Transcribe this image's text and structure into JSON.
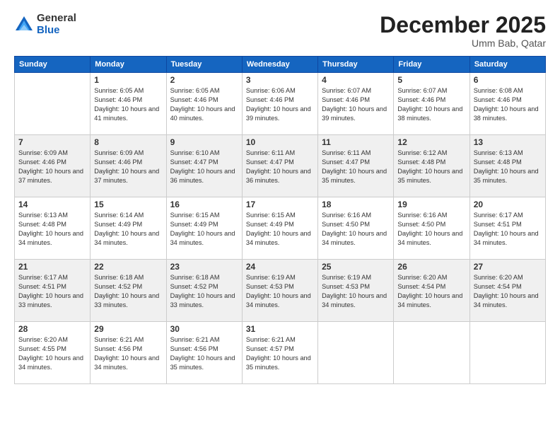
{
  "logo": {
    "general": "General",
    "blue": "Blue"
  },
  "title": "December 2025",
  "location": "Umm Bab, Qatar",
  "days_of_week": [
    "Sunday",
    "Monday",
    "Tuesday",
    "Wednesday",
    "Thursday",
    "Friday",
    "Saturday"
  ],
  "weeks": [
    [
      {
        "day": "",
        "sunrise": "",
        "sunset": "",
        "daylight": ""
      },
      {
        "day": "1",
        "sunrise": "Sunrise: 6:05 AM",
        "sunset": "Sunset: 4:46 PM",
        "daylight": "Daylight: 10 hours and 41 minutes."
      },
      {
        "day": "2",
        "sunrise": "Sunrise: 6:05 AM",
        "sunset": "Sunset: 4:46 PM",
        "daylight": "Daylight: 10 hours and 40 minutes."
      },
      {
        "day": "3",
        "sunrise": "Sunrise: 6:06 AM",
        "sunset": "Sunset: 4:46 PM",
        "daylight": "Daylight: 10 hours and 39 minutes."
      },
      {
        "day": "4",
        "sunrise": "Sunrise: 6:07 AM",
        "sunset": "Sunset: 4:46 PM",
        "daylight": "Daylight: 10 hours and 39 minutes."
      },
      {
        "day": "5",
        "sunrise": "Sunrise: 6:07 AM",
        "sunset": "Sunset: 4:46 PM",
        "daylight": "Daylight: 10 hours and 38 minutes."
      },
      {
        "day": "6",
        "sunrise": "Sunrise: 6:08 AM",
        "sunset": "Sunset: 4:46 PM",
        "daylight": "Daylight: 10 hours and 38 minutes."
      }
    ],
    [
      {
        "day": "7",
        "sunrise": "Sunrise: 6:09 AM",
        "sunset": "Sunset: 4:46 PM",
        "daylight": "Daylight: 10 hours and 37 minutes."
      },
      {
        "day": "8",
        "sunrise": "Sunrise: 6:09 AM",
        "sunset": "Sunset: 4:46 PM",
        "daylight": "Daylight: 10 hours and 37 minutes."
      },
      {
        "day": "9",
        "sunrise": "Sunrise: 6:10 AM",
        "sunset": "Sunset: 4:47 PM",
        "daylight": "Daylight: 10 hours and 36 minutes."
      },
      {
        "day": "10",
        "sunrise": "Sunrise: 6:11 AM",
        "sunset": "Sunset: 4:47 PM",
        "daylight": "Daylight: 10 hours and 36 minutes."
      },
      {
        "day": "11",
        "sunrise": "Sunrise: 6:11 AM",
        "sunset": "Sunset: 4:47 PM",
        "daylight": "Daylight: 10 hours and 35 minutes."
      },
      {
        "day": "12",
        "sunrise": "Sunrise: 6:12 AM",
        "sunset": "Sunset: 4:48 PM",
        "daylight": "Daylight: 10 hours and 35 minutes."
      },
      {
        "day": "13",
        "sunrise": "Sunrise: 6:13 AM",
        "sunset": "Sunset: 4:48 PM",
        "daylight": "Daylight: 10 hours and 35 minutes."
      }
    ],
    [
      {
        "day": "14",
        "sunrise": "Sunrise: 6:13 AM",
        "sunset": "Sunset: 4:48 PM",
        "daylight": "Daylight: 10 hours and 34 minutes."
      },
      {
        "day": "15",
        "sunrise": "Sunrise: 6:14 AM",
        "sunset": "Sunset: 4:49 PM",
        "daylight": "Daylight: 10 hours and 34 minutes."
      },
      {
        "day": "16",
        "sunrise": "Sunrise: 6:15 AM",
        "sunset": "Sunset: 4:49 PM",
        "daylight": "Daylight: 10 hours and 34 minutes."
      },
      {
        "day": "17",
        "sunrise": "Sunrise: 6:15 AM",
        "sunset": "Sunset: 4:49 PM",
        "daylight": "Daylight: 10 hours and 34 minutes."
      },
      {
        "day": "18",
        "sunrise": "Sunrise: 6:16 AM",
        "sunset": "Sunset: 4:50 PM",
        "daylight": "Daylight: 10 hours and 34 minutes."
      },
      {
        "day": "19",
        "sunrise": "Sunrise: 6:16 AM",
        "sunset": "Sunset: 4:50 PM",
        "daylight": "Daylight: 10 hours and 34 minutes."
      },
      {
        "day": "20",
        "sunrise": "Sunrise: 6:17 AM",
        "sunset": "Sunset: 4:51 PM",
        "daylight": "Daylight: 10 hours and 34 minutes."
      }
    ],
    [
      {
        "day": "21",
        "sunrise": "Sunrise: 6:17 AM",
        "sunset": "Sunset: 4:51 PM",
        "daylight": "Daylight: 10 hours and 33 minutes."
      },
      {
        "day": "22",
        "sunrise": "Sunrise: 6:18 AM",
        "sunset": "Sunset: 4:52 PM",
        "daylight": "Daylight: 10 hours and 33 minutes."
      },
      {
        "day": "23",
        "sunrise": "Sunrise: 6:18 AM",
        "sunset": "Sunset: 4:52 PM",
        "daylight": "Daylight: 10 hours and 33 minutes."
      },
      {
        "day": "24",
        "sunrise": "Sunrise: 6:19 AM",
        "sunset": "Sunset: 4:53 PM",
        "daylight": "Daylight: 10 hours and 34 minutes."
      },
      {
        "day": "25",
        "sunrise": "Sunrise: 6:19 AM",
        "sunset": "Sunset: 4:53 PM",
        "daylight": "Daylight: 10 hours and 34 minutes."
      },
      {
        "day": "26",
        "sunrise": "Sunrise: 6:20 AM",
        "sunset": "Sunset: 4:54 PM",
        "daylight": "Daylight: 10 hours and 34 minutes."
      },
      {
        "day": "27",
        "sunrise": "Sunrise: 6:20 AM",
        "sunset": "Sunset: 4:54 PM",
        "daylight": "Daylight: 10 hours and 34 minutes."
      }
    ],
    [
      {
        "day": "28",
        "sunrise": "Sunrise: 6:20 AM",
        "sunset": "Sunset: 4:55 PM",
        "daylight": "Daylight: 10 hours and 34 minutes."
      },
      {
        "day": "29",
        "sunrise": "Sunrise: 6:21 AM",
        "sunset": "Sunset: 4:56 PM",
        "daylight": "Daylight: 10 hours and 34 minutes."
      },
      {
        "day": "30",
        "sunrise": "Sunrise: 6:21 AM",
        "sunset": "Sunset: 4:56 PM",
        "daylight": "Daylight: 10 hours and 35 minutes."
      },
      {
        "day": "31",
        "sunrise": "Sunrise: 6:21 AM",
        "sunset": "Sunset: 4:57 PM",
        "daylight": "Daylight: 10 hours and 35 minutes."
      },
      {
        "day": "",
        "sunrise": "",
        "sunset": "",
        "daylight": ""
      },
      {
        "day": "",
        "sunrise": "",
        "sunset": "",
        "daylight": ""
      },
      {
        "day": "",
        "sunrise": "",
        "sunset": "",
        "daylight": ""
      }
    ]
  ]
}
